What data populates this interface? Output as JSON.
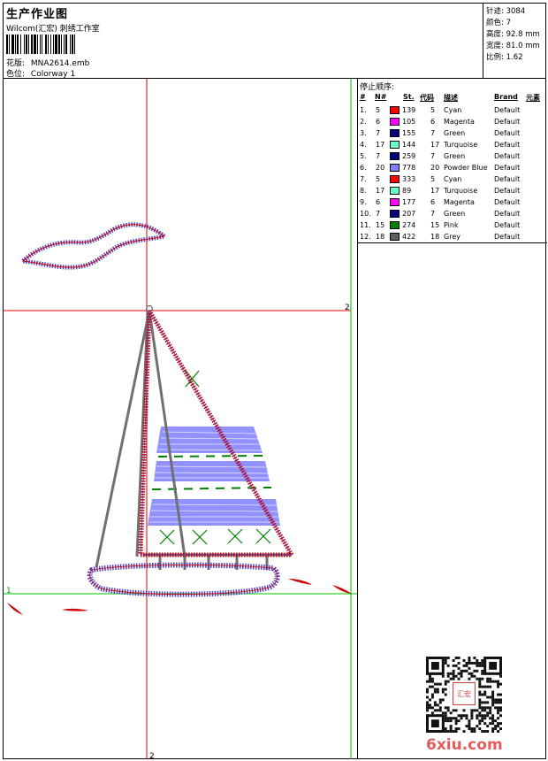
{
  "header": {
    "title": "生产作业图",
    "company": "Wilcom(汇宏) 刺绣工作室",
    "design_label": "花版:",
    "design_value": "MNA2614.emb",
    "colorway_label": "色位:",
    "colorway_value": "Colorway 1"
  },
  "stats": [
    {
      "label": "针迹:",
      "value": "3084"
    },
    {
      "label": "颜色:",
      "value": "7"
    },
    {
      "label": "高度:",
      "value": "92.8 mm"
    },
    {
      "label": "宽度:",
      "value": "81.0 mm"
    },
    {
      "label": "比例:",
      "value": "1.62"
    }
  ],
  "stops": {
    "title": "停止顺序:",
    "headers": {
      "num": "#",
      "needle": "N#",
      "st": "St.",
      "code": "代码",
      "desc": "描述",
      "brand": "Brand",
      "element": "元素"
    },
    "rows": [
      {
        "num": "1.",
        "needle": "5",
        "color": "#ff0000",
        "st": "139",
        "code": "5",
        "desc": "Cyan",
        "brand": "Default"
      },
      {
        "num": "2.",
        "needle": "6",
        "color": "#ff00ff",
        "st": "105",
        "code": "6",
        "desc": "Magenta",
        "brand": "Default"
      },
      {
        "num": "3.",
        "needle": "7",
        "color": "#000080",
        "st": "155",
        "code": "7",
        "desc": "Green",
        "brand": "Default"
      },
      {
        "num": "4.",
        "needle": "17",
        "color": "#66ffcc",
        "st": "144",
        "code": "17",
        "desc": "Turquoise",
        "brand": "Default"
      },
      {
        "num": "5.",
        "needle": "7",
        "color": "#000080",
        "st": "259",
        "code": "7",
        "desc": "Green",
        "brand": "Default"
      },
      {
        "num": "6.",
        "needle": "20",
        "color": "#8080ff",
        "st": "778",
        "code": "20",
        "desc": "Powder Blue",
        "brand": "Default"
      },
      {
        "num": "7.",
        "needle": "5",
        "color": "#ff0000",
        "st": "333",
        "code": "5",
        "desc": "Cyan",
        "brand": "Default"
      },
      {
        "num": "8.",
        "needle": "17",
        "color": "#66ffcc",
        "st": "89",
        "code": "17",
        "desc": "Turquoise",
        "brand": "Default"
      },
      {
        "num": "9.",
        "needle": "6",
        "color": "#ff00ff",
        "st": "177",
        "code": "6",
        "desc": "Magenta",
        "brand": "Default"
      },
      {
        "num": "10.",
        "needle": "7",
        "color": "#000080",
        "st": "207",
        "code": "7",
        "desc": "Green",
        "brand": "Default"
      },
      {
        "num": "11.",
        "needle": "15",
        "color": "#008000",
        "st": "274",
        "code": "15",
        "desc": "Pink",
        "brand": "Default"
      },
      {
        "num": "12.",
        "needle": "18",
        "color": "#606060",
        "st": "422",
        "code": "18",
        "desc": "Grey",
        "brand": "Default"
      }
    ]
  },
  "drawing": {
    "marker_top_right": "2",
    "marker_left": "1",
    "marker_bottom": "2"
  },
  "footer": {
    "seal_text": "汇宏",
    "logo": "6xiu.com"
  },
  "colors": {
    "guide_red": "#e00000",
    "guide_green": "#00c000",
    "satin_red": "#d00000",
    "satin_purple": "#5040c0",
    "fill_blue": "#7f7fff",
    "mast_grey": "#707070",
    "x_green": "#008000",
    "logo_red": "#e35d5d"
  }
}
